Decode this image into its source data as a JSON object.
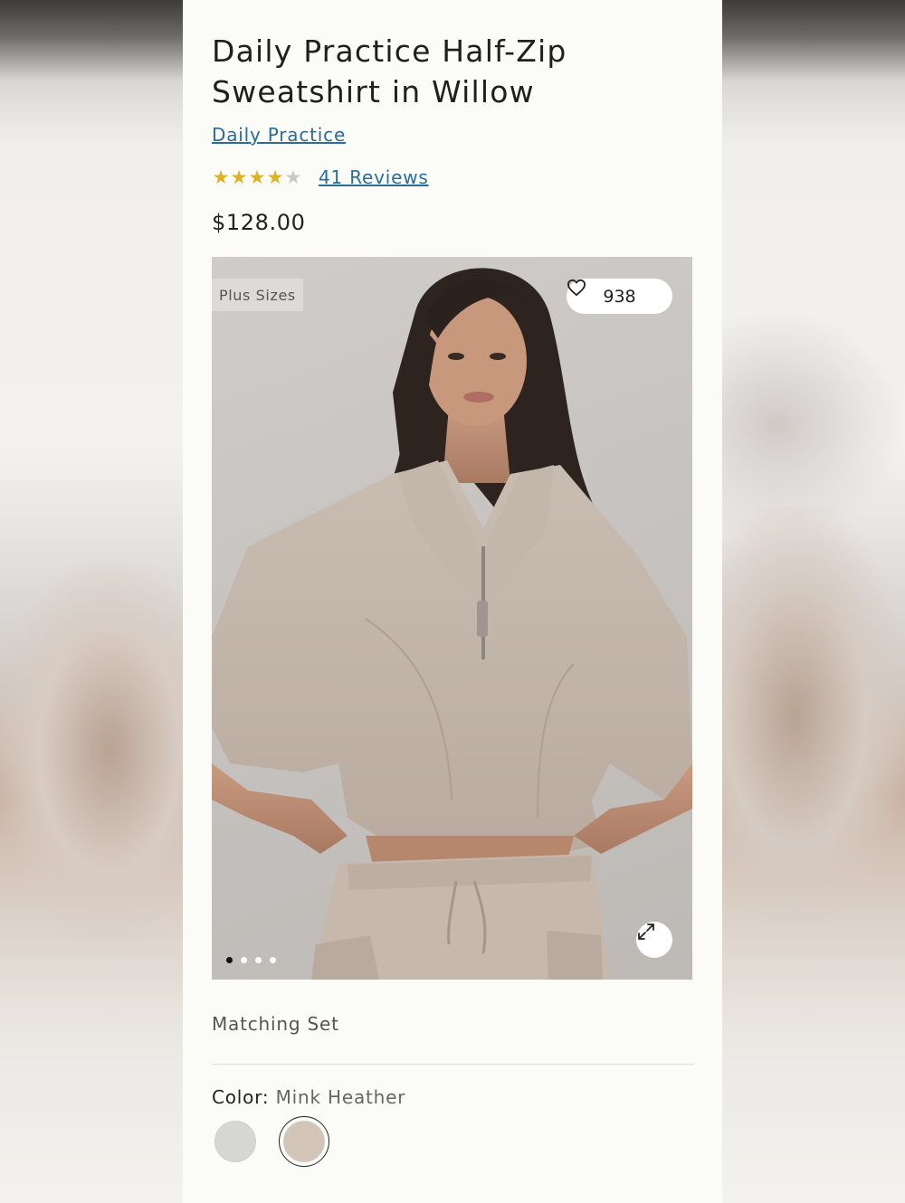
{
  "product": {
    "title_line1": "Daily Practice Half-Zip",
    "title_line2": "Sweatshirt in Willow",
    "brand": "Daily Practice",
    "rating": 4,
    "rating_max": 5,
    "reviews_label": "41 Reviews",
    "price": "$128.00"
  },
  "image": {
    "badge": "Plus Sizes",
    "likes": "938",
    "carousel_count": 4,
    "carousel_active": 1
  },
  "details": {
    "matching_set": "Matching Set",
    "color_label": "Color:",
    "color_value": "Mink Heather",
    "swatches": [
      {
        "name": "light-grey-heather",
        "color": "#d6d6d3",
        "selected": false
      },
      {
        "name": "mink-heather",
        "color": "#d2c5b7",
        "selected": true
      }
    ]
  },
  "colors": {
    "link": "#2b6d94",
    "star": "#e1b21f",
    "panel_bg": "#fbfbf8"
  }
}
